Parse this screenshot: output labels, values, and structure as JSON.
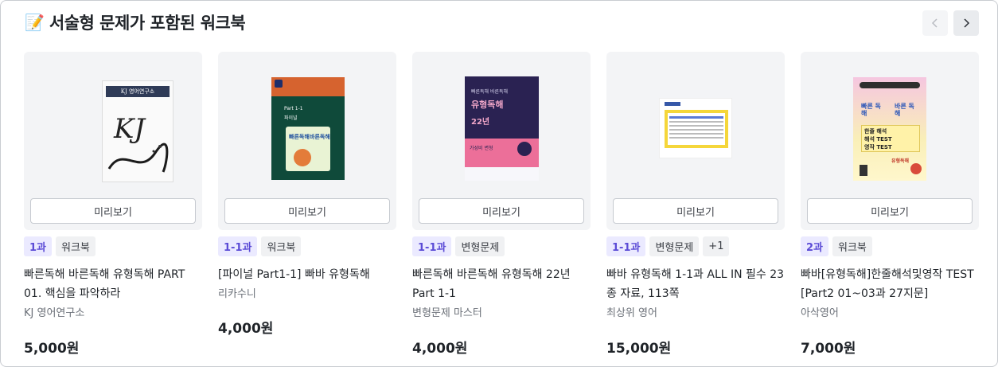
{
  "section": {
    "icon": "memo-icon",
    "title": "서술형 문제가 포함된 워크북"
  },
  "nav": {
    "prev": "chevron-left-icon",
    "next": "chevron-right-icon"
  },
  "preview_label": "미리보기",
  "products": [
    {
      "tags": [
        "1과",
        "워크북"
      ],
      "name": "빠른독해 바른독해 유형독해 PART 01. 핵심을 파악하라",
      "seller": "KJ 영어연구소",
      "price": "5,000원",
      "cover_text": [
        "KJ 영어연구소",
        "KJ"
      ]
    },
    {
      "tags": [
        "1-1과",
        "워크북"
      ],
      "name": "[파이널 Part1-1] 빠바 유형독해",
      "seller": "리카수니",
      "price": "4,000원",
      "cover_text": [
        "Part 1-1",
        "파이널",
        "빠른독해",
        "바른독해"
      ]
    },
    {
      "tags": [
        "1-1과",
        "변형문제"
      ],
      "name": "빠른독해 바른독해 유형독해 22년 Part 1-1",
      "seller": "변형문제 마스터",
      "price": "4,000원",
      "cover_text": [
        "빠른독해 바른독해",
        "유형독해",
        "22년",
        "가성비 변형"
      ]
    },
    {
      "tags": [
        "1-1과",
        "변형문제",
        "+1"
      ],
      "name": "빠바 유형독해 1-1과 ALL IN 필수 23종 자료, 113쪽",
      "seller": "최상위 영어",
      "price": "15,000원",
      "cover_text": []
    },
    {
      "tags": [
        "2과",
        "워크북"
      ],
      "name": "빠바[유형독해]한줄해석및영작 TEST [Part2 01~03과 27지문]",
      "seller": "아삭영어",
      "price": "7,000원",
      "cover_text": [
        "빠른 독해",
        "바른 독해",
        "한줄 해석",
        "해석 TEST",
        "영작 TEST",
        "유형독해"
      ]
    }
  ]
}
